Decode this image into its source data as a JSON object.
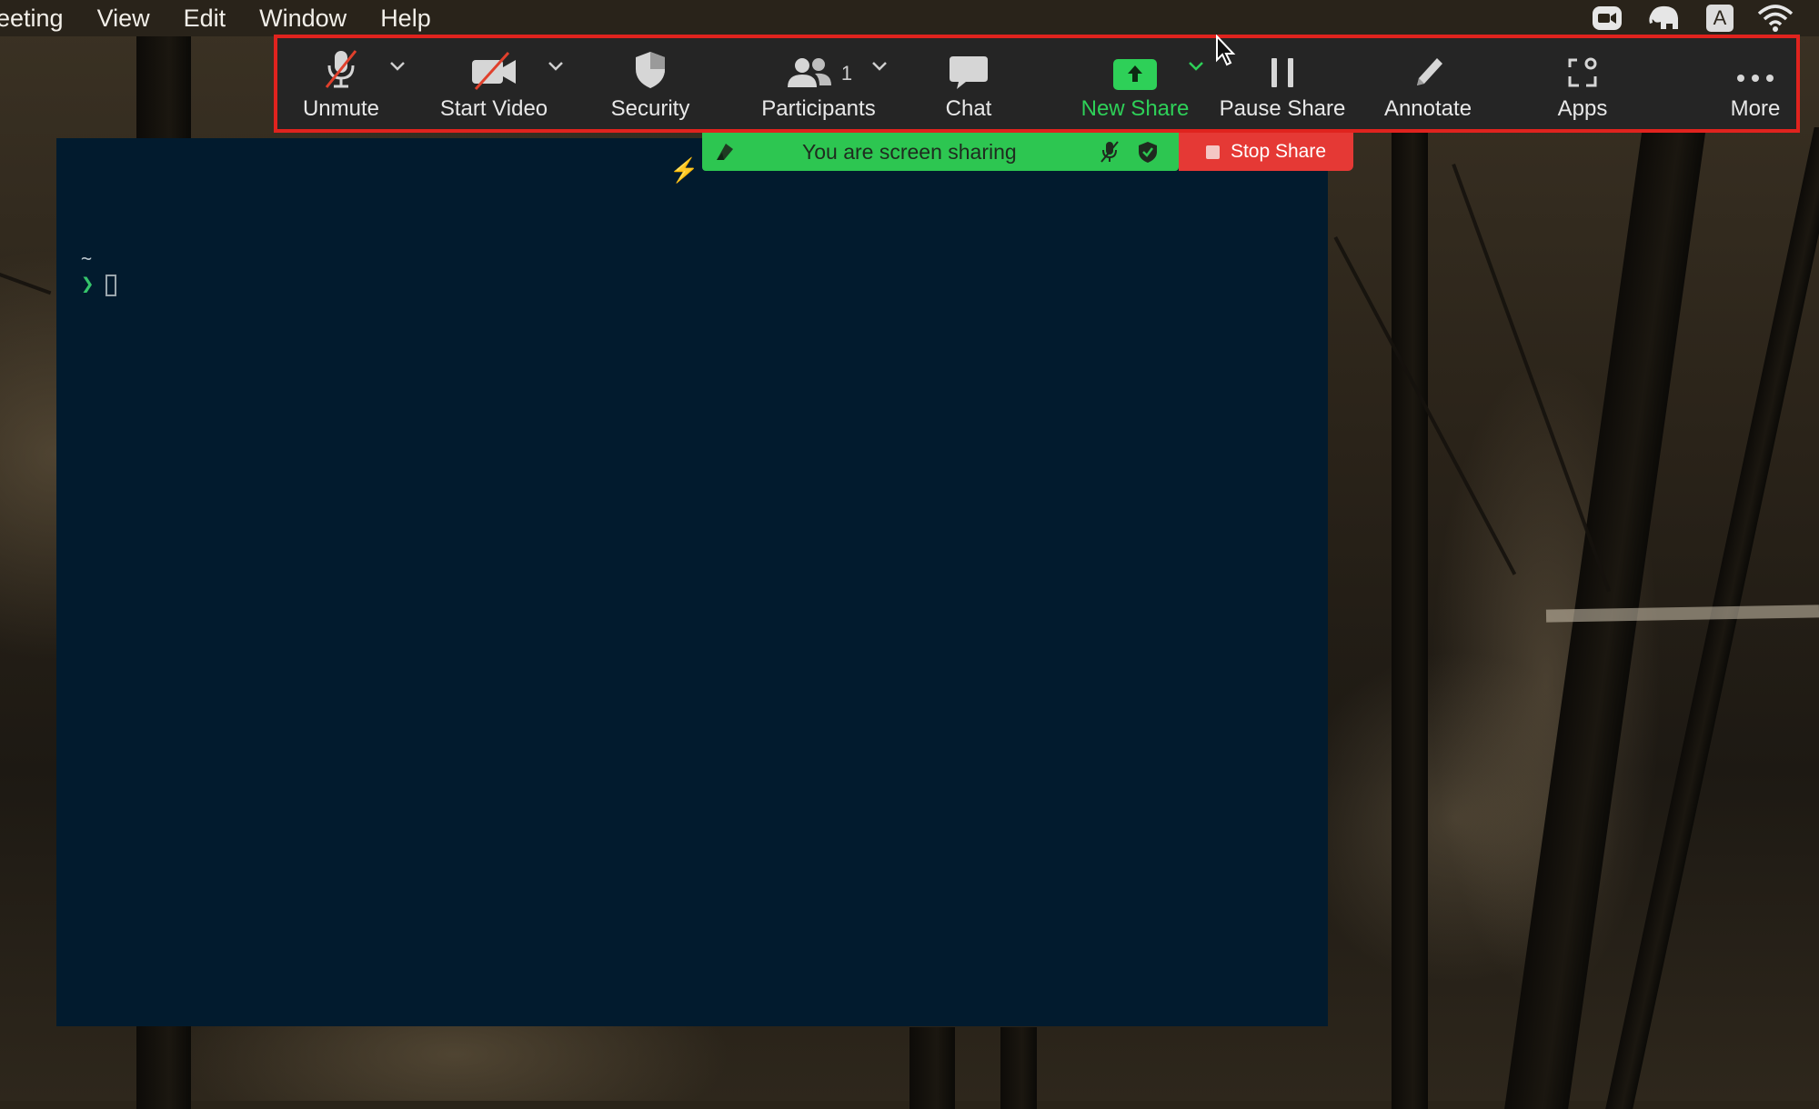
{
  "menubar": {
    "items": [
      "eeting",
      "View",
      "Edit",
      "Window",
      "Help"
    ],
    "status_icons": [
      "zoom-camera-icon",
      "evernote-elephant-icon",
      "keyboard-input-icon",
      "wifi-icon"
    ],
    "input_source": "A"
  },
  "toolbar": {
    "buttons": [
      {
        "label": "Unmute",
        "icon": "microphone-muted-icon",
        "has_caret": true
      },
      {
        "label": "Start Video",
        "icon": "video-off-icon",
        "has_caret": true
      },
      {
        "label": "Security",
        "icon": "shield-icon",
        "has_caret": false
      },
      {
        "label": "Participants",
        "icon": "participants-icon",
        "count": "1",
        "has_caret": true
      },
      {
        "label": "Chat",
        "icon": "chat-bubble-icon",
        "has_caret": false
      },
      {
        "label": "New Share",
        "icon": "share-arrow-up-icon",
        "has_caret": true
      },
      {
        "label": "Pause Share",
        "icon": "pause-icon",
        "has_caret": false
      },
      {
        "label": "Annotate",
        "icon": "pencil-icon",
        "has_caret": false
      },
      {
        "label": "Apps",
        "icon": "apps-icon",
        "has_caret": false
      },
      {
        "label": "More",
        "icon": "ellipsis-icon",
        "has_caret": false
      }
    ],
    "highlight_color": "#e0231e",
    "accent_green": "#2ed058"
  },
  "share_bar": {
    "message": "You are screen sharing",
    "stop_label": "Stop Share",
    "bar_color": "#2dc651",
    "stop_color": "#e53935"
  },
  "terminal": {
    "cwd": "~",
    "prompt_symbol": "❯",
    "background": "#021b2e"
  }
}
